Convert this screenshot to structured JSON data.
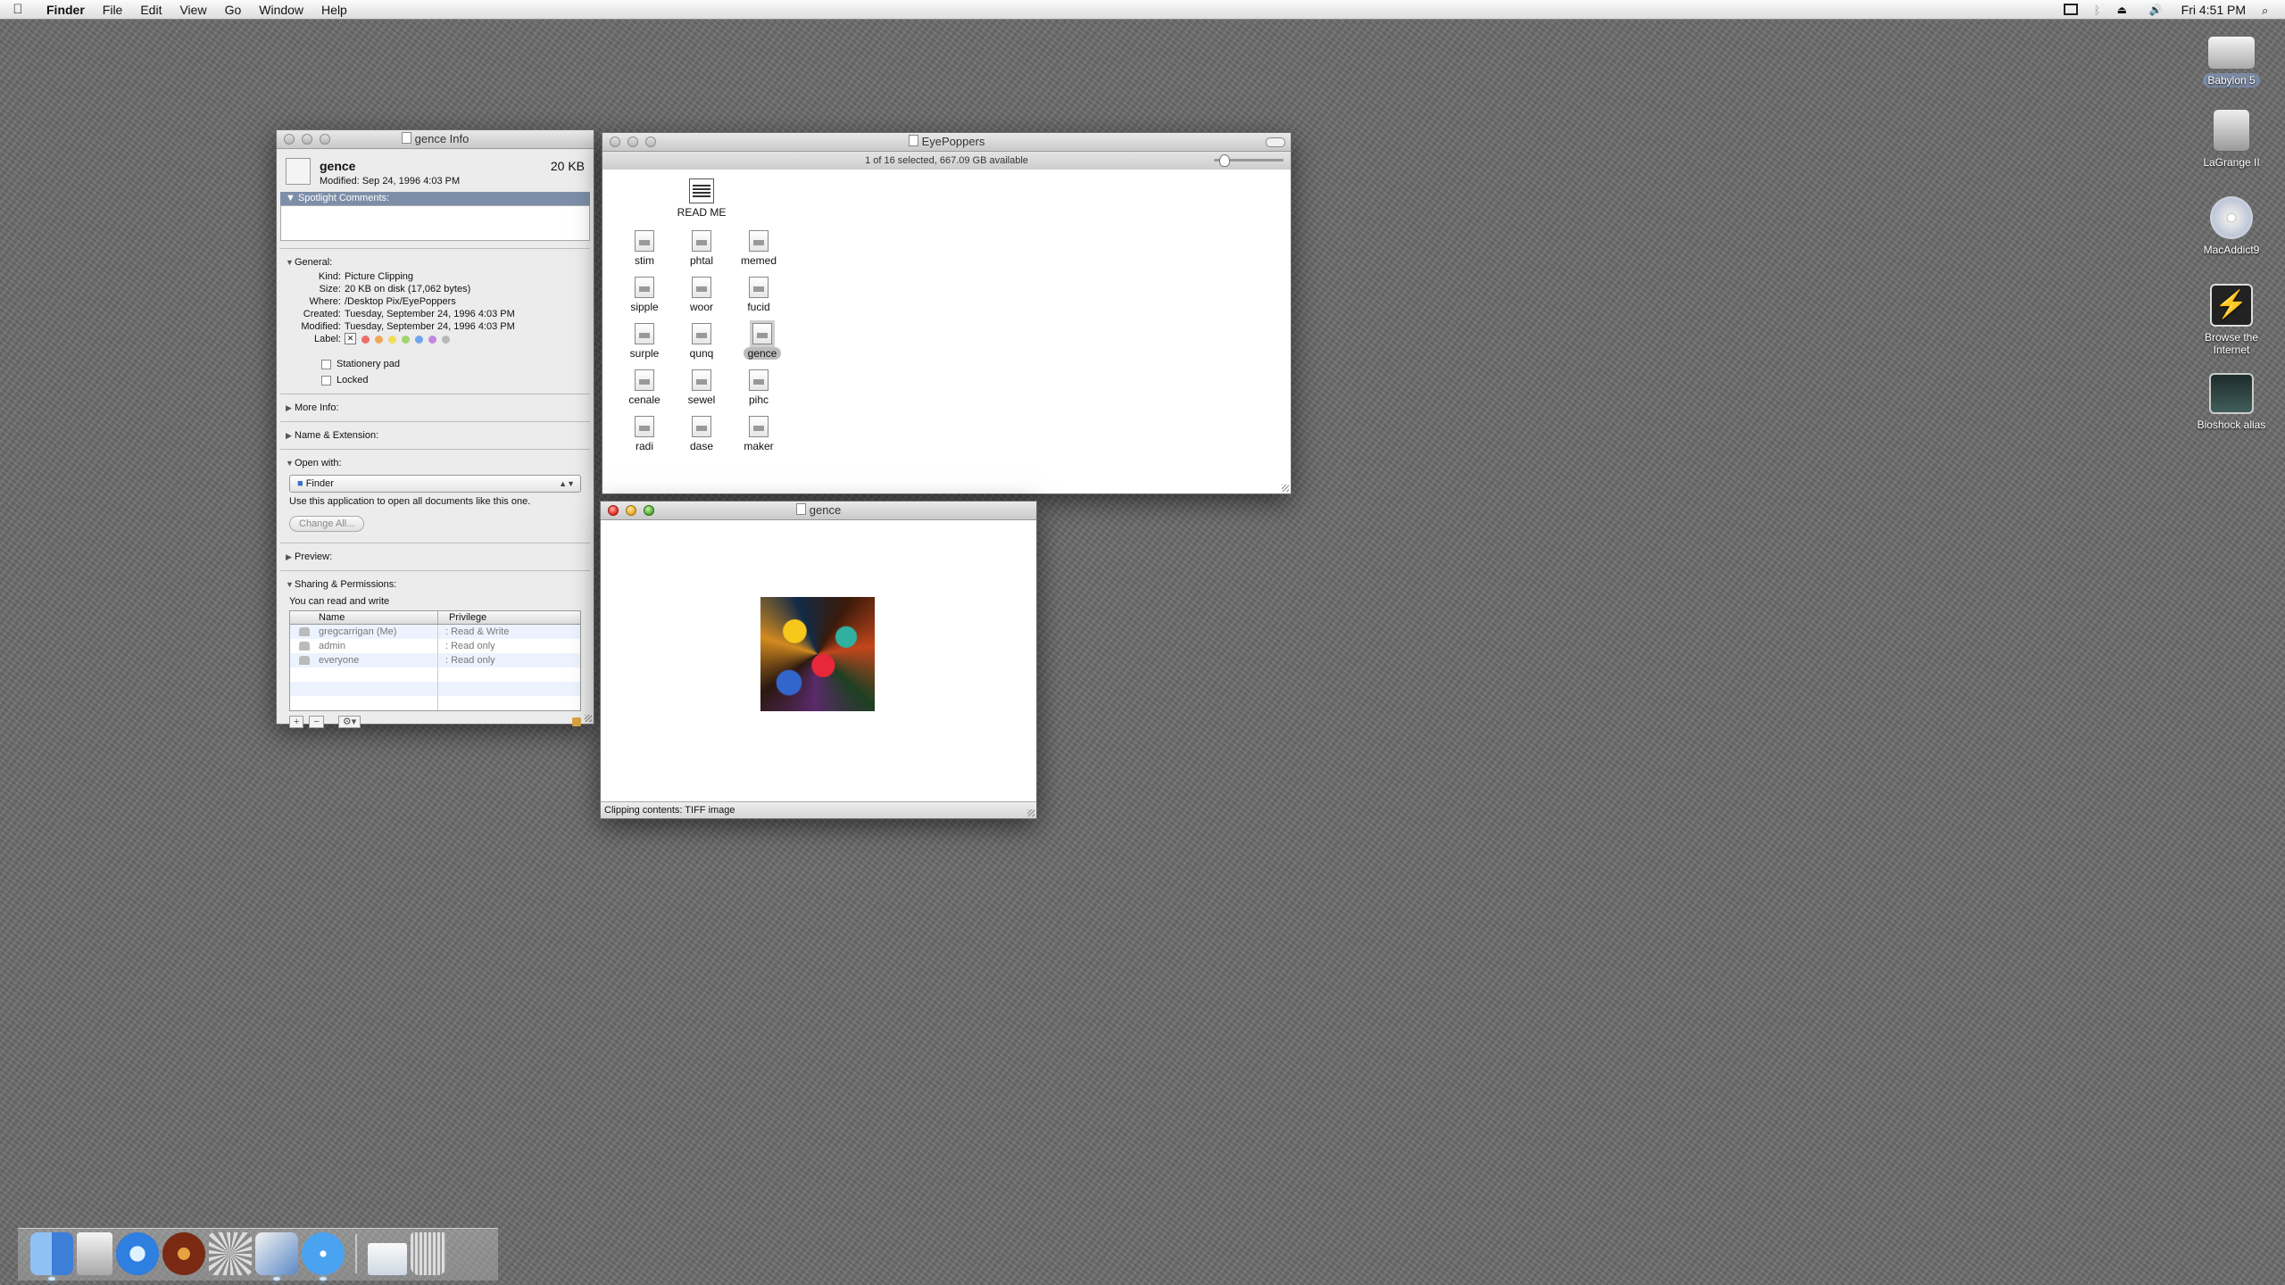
{
  "menubar": {
    "app": "Finder",
    "menus": [
      "File",
      "Edit",
      "View",
      "Go",
      "Window",
      "Help"
    ],
    "clock": "Fri 4:51 PM",
    "status_icons": [
      "display-icon",
      "bluetooth-icon",
      "eject-icon",
      "volume-icon",
      "spotlight-icon"
    ]
  },
  "desktop": {
    "icons": [
      {
        "label": "Babylon 5",
        "icon": "hard-drive-icon"
      },
      {
        "label": "LaGrange II",
        "icon": "external-drive-icon"
      },
      {
        "label": "MacAddict9",
        "icon": "cd-icon"
      },
      {
        "label": "Browse the Internet",
        "icon": "lightning-icon"
      },
      {
        "label": "Bioshock alias",
        "icon": "monitor-icon"
      }
    ]
  },
  "info_window": {
    "title": "gence Info",
    "name": "gence",
    "size": "20 KB",
    "modified_short": "Modified: Sep 24, 1996 4:03 PM",
    "spotlight_label": "Spotlight Comments:",
    "general_label": "General:",
    "general": [
      {
        "k": "Kind:",
        "v": "Picture Clipping"
      },
      {
        "k": "Size:",
        "v": "20 KB on disk (17,062 bytes)"
      },
      {
        "k": "Where:",
        "v": "/Desktop Pix/EyePoppers"
      },
      {
        "k": "Created:",
        "v": "Tuesday, September 24, 1996 4:03 PM"
      },
      {
        "k": "Modified:",
        "v": "Tuesday, September 24, 1996 4:03 PM"
      },
      {
        "k": "Label:",
        "v": ""
      }
    ],
    "label_x": "✕",
    "label_colors": [
      "#ef6b6b",
      "#f2a65a",
      "#f1dd5a",
      "#9fd66a",
      "#6fa7ee",
      "#c189e0",
      "#b8b8b8"
    ],
    "stationery": "Stationery pad",
    "locked": "Locked",
    "more_info": "More Info:",
    "name_ext": "Name & Extension:",
    "open_with": "Open with:",
    "open_app": "Finder",
    "open_note": "Use this application to open all documents like this one.",
    "change_all": "Change All...",
    "preview": "Preview:",
    "sharing": "Sharing & Permissions:",
    "sharing_note": "You can read and write",
    "perm_headers": {
      "name": "Name",
      "privilege": "Privilege"
    },
    "perms": [
      {
        "name": "gregcarrigan (Me)",
        "priv": ": Read & Write"
      },
      {
        "name": "admin",
        "priv": ": Read only"
      },
      {
        "name": "everyone",
        "priv": ": Read only"
      }
    ],
    "plus": "+",
    "minus": "−",
    "gear": "⚙▾"
  },
  "finder_window": {
    "title": "EyePoppers",
    "status": "1 of 16 selected, 667.09 GB available",
    "files": [
      "READ ME",
      "stim",
      "phtal",
      "memed",
      "sipple",
      "woor",
      "fucid",
      "surple",
      "qunq",
      "gence",
      "cenale",
      "sewel",
      "pihc",
      "radi",
      "dase",
      "maker"
    ],
    "selected": "gence"
  },
  "clip_window": {
    "title": "gence",
    "status": "Clipping contents: TIFF image"
  },
  "dock": {
    "items": [
      "finder-icon",
      "mail-icon",
      "itunes-icon",
      "game-icon",
      "system-preferences-icon",
      "preview-icon",
      "safari-icon",
      "documents-stack-icon",
      "trash-icon"
    ]
  },
  "colors": {
    "selection": "#7d8ea8",
    "desktop": "#6e6e6e"
  }
}
